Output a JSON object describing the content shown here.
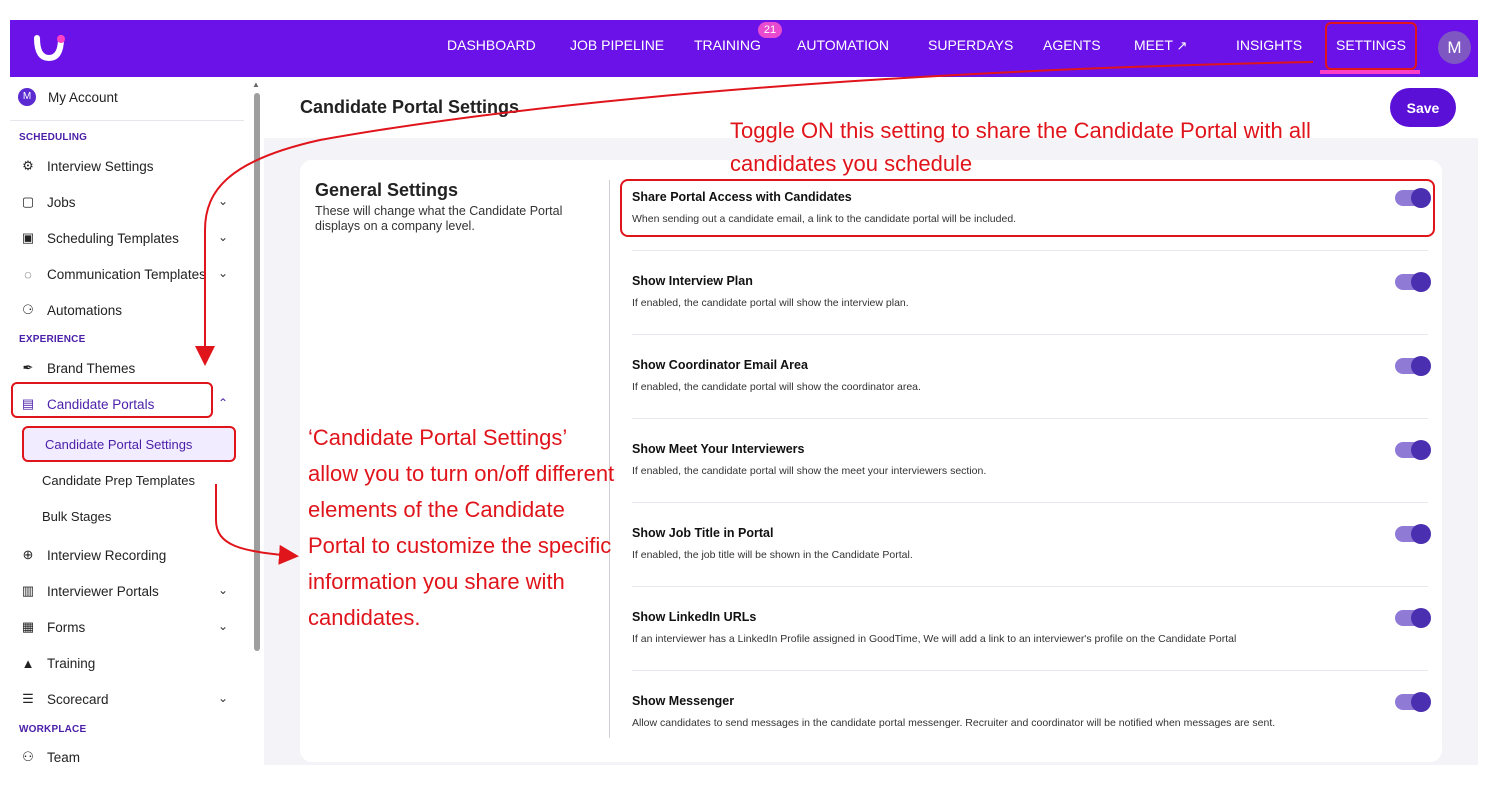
{
  "topbar": {
    "nav": [
      "DASHBOARD",
      "JOB PIPELINE",
      "TRAINING",
      "AUTOMATION",
      "SUPERDAYS",
      "AGENTS",
      "MEET",
      "INSIGHTS",
      "SETTINGS"
    ],
    "training_badge": "21",
    "avatar": "M",
    "accent_color": "#6b12e8"
  },
  "sidebar": {
    "my_account": "My Account",
    "my_account_avatar": "M",
    "sections": {
      "scheduling": "SCHEDULING",
      "experience": "EXPERIENCE",
      "workplace": "WORKPLACE"
    },
    "items": [
      "Interview Settings",
      "Jobs",
      "Scheduling Templates",
      "Communication Templates",
      "Automations",
      "Brand Themes",
      "Candidate Portals",
      "Interview Recording",
      "Interviewer Portals",
      "Forms",
      "Training",
      "Scorecard",
      "Team"
    ],
    "sub_items": [
      "Candidate Portal Settings",
      "Candidate Prep Templates",
      "Bulk Stages"
    ]
  },
  "main": {
    "title": "Candidate Portal Settings",
    "save_label": "Save",
    "general_title": "General Settings",
    "general_desc": "These will change what the Candidate Portal displays on a company level.",
    "settings": [
      {
        "title": "Share Portal Access with Candidates",
        "desc": "When sending out a candidate email, a link to the candidate portal will be included.",
        "enabled": true
      },
      {
        "title": "Show Interview Plan",
        "desc": "If enabled, the candidate portal will show the interview plan.",
        "enabled": true
      },
      {
        "title": "Show Coordinator Email Area",
        "desc": "If enabled, the candidate portal will show the coordinator area.",
        "enabled": true
      },
      {
        "title": "Show Meet Your Interviewers",
        "desc": "If enabled, the candidate portal will show the meet your interviewers section.",
        "enabled": true
      },
      {
        "title": "Show Job Title in Portal",
        "desc": "If enabled, the job title will be shown in the Candidate Portal.",
        "enabled": true
      },
      {
        "title": "Show LinkedIn URLs",
        "desc": "If an interviewer has a LinkedIn Profile assigned in GoodTime, We will add a link to an interviewer's profile on the Candidate Portal",
        "enabled": true
      },
      {
        "title": "Show Messenger",
        "desc": "Allow candidates to send messages in the candidate portal messenger. Recruiter and coordinator will be notified when messages are sent.",
        "enabled": true
      }
    ]
  },
  "annotations": {
    "top": "Toggle ON this setting to share the Candidate Portal with all candidates you schedule",
    "left": "‘Candidate Portal Settings’ allow you to turn on/off different elements of the Candidate Portal to customize the specific information you share with candidates.",
    "color": "#e0141b"
  }
}
